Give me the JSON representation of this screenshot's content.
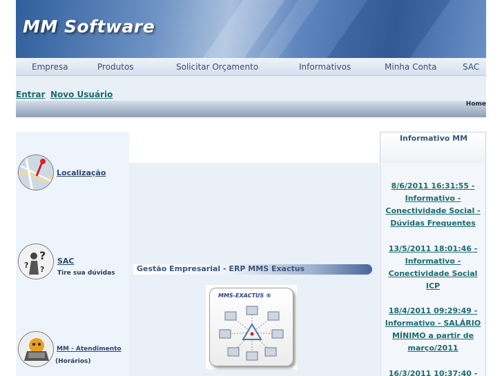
{
  "header": {
    "brand": "MM Software"
  },
  "nav": {
    "items": [
      {
        "label": "Empresa"
      },
      {
        "label": "Produtos"
      },
      {
        "label": "Solicitar Orçamento"
      },
      {
        "label": "Informativos"
      },
      {
        "label": "Minha Conta"
      },
      {
        "label": "SAC"
      }
    ]
  },
  "account": {
    "login": "Entrar",
    "new_user": "Novo Usuário"
  },
  "breadcrumb": {
    "home": "Home"
  },
  "sidebar": {
    "location": {
      "label": "Localização",
      "icon": "map-pin-icon"
    },
    "sac": {
      "label": "SAC",
      "sub": "Tire sua dúvidas",
      "icon": "help-person-icon"
    },
    "support": {
      "label": "MM - Atendimento",
      "sub": "(Horários)",
      "icon": "support-laptop-icon"
    }
  },
  "main": {
    "section_title": "Gestão Empresarial - ERP MMS Exactus",
    "product_label": "MMS-EXACTUS ®"
  },
  "news": {
    "title": "Informativo MM",
    "items": [
      {
        "text": "8/6/2011 16:31:55 - Informativo - Conectividade Social - Dúvidas Frequentes"
      },
      {
        "text": "13/5/2011 18:01:46 - Informativo - Conectividade Social ICP"
      },
      {
        "text": "18/4/2011 09:29:49 - Informativo - SALÁRIO MÍNIMO a partir de março/2011"
      },
      {
        "text": "16/3/2011 10:37:40 -"
      }
    ]
  },
  "colors": {
    "accent": "#1c6b6e",
    "banner": "#3b67a5",
    "nav_text": "#3d4e66"
  }
}
